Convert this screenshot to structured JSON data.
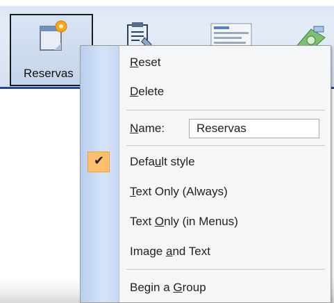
{
  "toolbar": {
    "buttons": [
      {
        "label": "Reservas",
        "icon": "calendar-sun-icon",
        "selected": true
      },
      {
        "icon": "clipboard-document-icon"
      },
      {
        "icon": "form-document-icon"
      },
      {
        "icon": "money-hand-icon"
      }
    ]
  },
  "context_menu": {
    "items": [
      {
        "id": "reset",
        "pre": "",
        "ul": "R",
        "post": "eset"
      },
      {
        "id": "delete",
        "pre": "",
        "ul": "D",
        "post": "elete"
      },
      {
        "id": "name",
        "pre": "",
        "ul": "N",
        "post": "ame:",
        "input_value": "Reservas"
      },
      {
        "id": "default-style",
        "pre": "Defa",
        "ul": "u",
        "post": "lt style",
        "checked": true
      },
      {
        "id": "text-only-always",
        "pre": "",
        "ul": "T",
        "post": "ext Only (Always)"
      },
      {
        "id": "text-only-menus",
        "pre": "Text ",
        "ul": "O",
        "post": "nly (in Menus)"
      },
      {
        "id": "image-and-text",
        "pre": "Image ",
        "ul": "a",
        "post": "nd Text"
      },
      {
        "id": "begin-group",
        "pre": "Begin a ",
        "ul": "G",
        "post": "roup"
      }
    ],
    "check_glyph": "✔",
    "colors": {
      "check_highlight": "#fdbf6b",
      "gutter": "#c7d9f2",
      "accent_line": "#1f4a9e"
    }
  }
}
